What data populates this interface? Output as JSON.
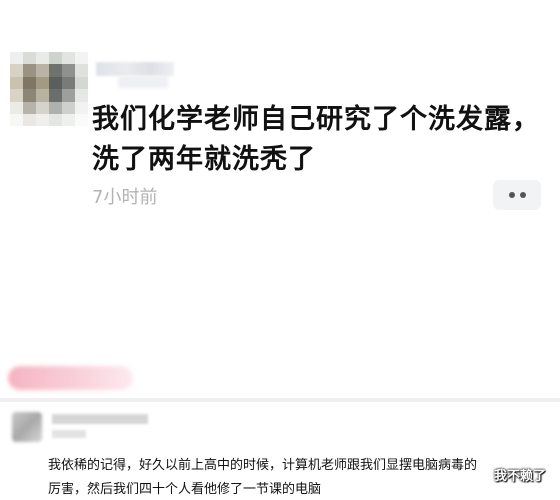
{
  "post": {
    "text_lines": [
      "我们化学老师自己研究了个洗发露，",
      "洗了两年就洗秃了"
    ],
    "timestamp": "7小时前"
  },
  "comment": {
    "text_lines": [
      "我依稀的记得，好久以前上高中的时候，计算机老师跟我们显摆电脑病毒的",
      "厉害，然后我们四十个人看他修了一节课的电脑"
    ]
  },
  "watermark": "我不赖了",
  "icons": {
    "more": "more-dots-icon"
  },
  "colors": {
    "text": "#111111",
    "timestamp": "#b3b3b3",
    "accent_pink": "#f6b3c2",
    "more_bg": "#f2f3f5"
  }
}
